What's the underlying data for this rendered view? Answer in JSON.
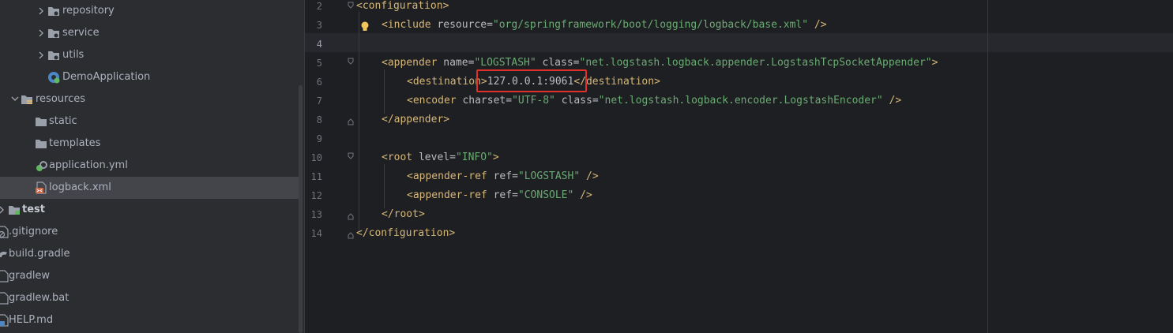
{
  "tree": {
    "items": [
      {
        "label": "repository",
        "icon": "folder-package-icon"
      },
      {
        "label": "service",
        "icon": "folder-package-icon"
      },
      {
        "label": "utils",
        "icon": "folder-package-icon"
      },
      {
        "label": "DemoApplication",
        "icon": "spring-class-icon"
      },
      {
        "label": "resources",
        "icon": "resources-folder-icon"
      },
      {
        "label": "static",
        "icon": "folder-icon"
      },
      {
        "label": "templates",
        "icon": "folder-icon"
      },
      {
        "label": "application.yml",
        "icon": "spring-yaml-icon"
      },
      {
        "label": "logback.xml",
        "icon": "xml-file-icon"
      },
      {
        "label": "test",
        "icon": "test-folder-icon"
      },
      {
        "label": ".gitignore",
        "icon": "gitignore-file-icon"
      },
      {
        "label": "build.gradle",
        "icon": "gradle-file-icon"
      },
      {
        "label": "gradlew",
        "icon": "file-icon"
      },
      {
        "label": "gradlew.bat",
        "icon": "file-icon"
      },
      {
        "label": "HELP.md",
        "icon": "markdown-file-icon"
      }
    ]
  },
  "editor": {
    "line_numbers": [
      "2",
      "3",
      "4",
      "5",
      "6",
      "7",
      "8",
      "9",
      "10",
      "11",
      "12",
      "13",
      "14"
    ],
    "current_line": "4",
    "lines": {
      "l2": {
        "open": "<",
        "tag": "configuration",
        "close": ">"
      },
      "l3": {
        "open": "<",
        "tag": "include",
        "attr1": "resource",
        "eq": "=",
        "val1": "\"org/springframework/boot/logging/logback/base.xml\"",
        "close": " />"
      },
      "l5": {
        "open": "<",
        "tag": "appender",
        "attr1": "name",
        "val1": "\"LOGSTASH\"",
        "attr2": "class",
        "val2": "\"net.logstash.logback.appender.LogstashTcpSocketAppender\"",
        "close": ">"
      },
      "l6": {
        "open": "<",
        "tag": "destination",
        "gt": ">",
        "text": "127.0.0.1:9061",
        "endopen": "</",
        "endtag": "destination",
        "close": ">"
      },
      "l7": {
        "open": "<",
        "tag": "encoder",
        "attr1": "charset",
        "val1": "\"UTF-8\"",
        "attr2": "class",
        "val2": "\"net.logstash.logback.encoder.LogstashEncoder\"",
        "close": " />"
      },
      "l8": {
        "open": "</",
        "tag": "appender",
        "close": ">"
      },
      "l10": {
        "open": "<",
        "tag": "root",
        "attr1": "level",
        "val1": "\"INFO\"",
        "close": ">"
      },
      "l11": {
        "open": "<",
        "tag": "appender-ref",
        "attr1": "ref",
        "val1": "\"LOGSTASH\"",
        "close": " />"
      },
      "l12": {
        "open": "<",
        "tag": "appender-ref",
        "attr1": "ref",
        "val1": "\"CONSOLE\"",
        "close": " />"
      },
      "l13": {
        "open": "</",
        "tag": "root",
        "close": ">"
      },
      "l14": {
        "open": "</",
        "tag": "configuration",
        "close": ">"
      }
    }
  },
  "colors": {
    "tag": "#d5b778",
    "attribute": "#bababa",
    "string": "#6aab73",
    "highlight_box": "#e0302a",
    "selection": "#43454a"
  }
}
